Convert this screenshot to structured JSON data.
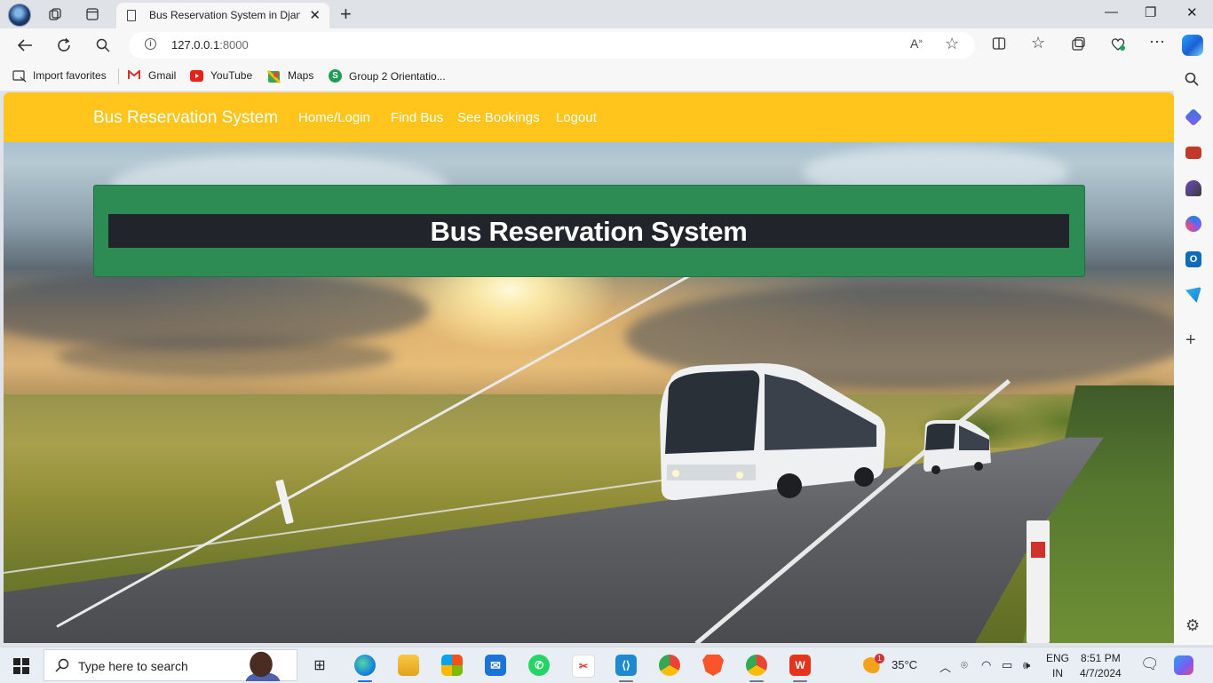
{
  "browser": {
    "tab_title": "Bus Reservation System in Django",
    "url_host": "127.0.0.1",
    "url_port": ":8000",
    "favorites": [
      {
        "label": "Import favorites"
      },
      {
        "label": "Gmail"
      },
      {
        "label": "YouTube"
      },
      {
        "label": "Maps"
      },
      {
        "label": "Group 2 Orientatio..."
      }
    ]
  },
  "page": {
    "navbar": {
      "brand": "Bus Reservation System",
      "links": [
        "Home/Login",
        "Find Bus",
        "See Bookings",
        "Logout"
      ],
      "color": "#ffc51c"
    },
    "jumbotron": {
      "title": "Bus Reservation System",
      "color": "#2d8b54"
    }
  },
  "taskbar": {
    "search_placeholder": "Type here to search",
    "weather": "35°C",
    "language_top": "ENG",
    "language_bottom": "IN",
    "time": "8:51 PM",
    "date": "4/7/2024",
    "weather_badge": "1"
  }
}
